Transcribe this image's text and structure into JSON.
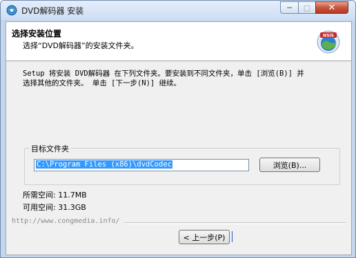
{
  "window": {
    "title": "DVD解码器 安装",
    "min_symbol": "─",
    "max_symbol": "□",
    "close_symbol": "✕"
  },
  "header": {
    "title": "选择安装位置",
    "subtitle": "选择“DVD解码器”的安装文件夹。",
    "logo_text": "NSIS"
  },
  "main": {
    "description_line1": "Setup 将安装 DVD解码器 在下列文件夹。要安装到不同文件夹，单击 [浏览(B)] 并",
    "description_line2": "选择其他的文件夹。 单击 [下一步(N)] 继续。",
    "destination_group_label": "目标文件夹",
    "install_path": "C:\\Program Files (x86)\\dvdCodec",
    "browse_label": "浏览(B)...",
    "space_required": "所需空间: 11.7MB",
    "space_available": "可用空间: 31.3GB"
  },
  "footer": {
    "branding_url": "http://www.congmedia.info/",
    "back_label": "< 上一步(P)"
  },
  "colors": {
    "title_gradient_top": "#e4eefb",
    "close_red": "#c9553d",
    "selection_blue": "#3399ff"
  }
}
